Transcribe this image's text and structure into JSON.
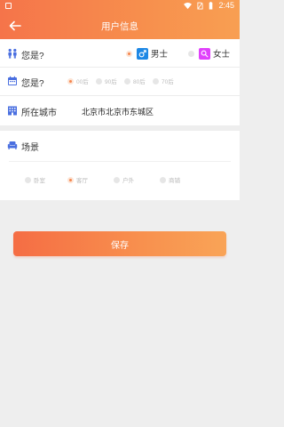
{
  "status_bar": {
    "time": "2:45"
  },
  "header": {
    "title": "用户信息"
  },
  "gender_row": {
    "label": "您是?",
    "options": [
      {
        "label": "男士",
        "selected": true,
        "badge_color": "#1e88e5",
        "badge_icon": "male-icon"
      },
      {
        "label": "女士",
        "selected": false,
        "badge_color": "#e040fb",
        "badge_icon": "female-icon"
      }
    ]
  },
  "age_row": {
    "label": "您是?",
    "options": [
      {
        "label": "00后",
        "selected": true
      },
      {
        "label": "90后",
        "selected": false
      },
      {
        "label": "80后",
        "selected": false
      },
      {
        "label": "70后",
        "selected": false
      }
    ]
  },
  "city_row": {
    "label": "所在城市",
    "value": "北京市北京市东城区"
  },
  "scene_row": {
    "label": "场景",
    "options": [
      {
        "label": "卧室",
        "selected": false
      },
      {
        "label": "客厅",
        "selected": true
      },
      {
        "label": "户外",
        "selected": false
      },
      {
        "label": "商铺",
        "selected": false
      }
    ]
  },
  "save_button": {
    "label": "保存"
  },
  "colors": {
    "accent": "#f5844c",
    "accent_light": "#f89f52",
    "icon_blue": "#4a6fe0"
  }
}
